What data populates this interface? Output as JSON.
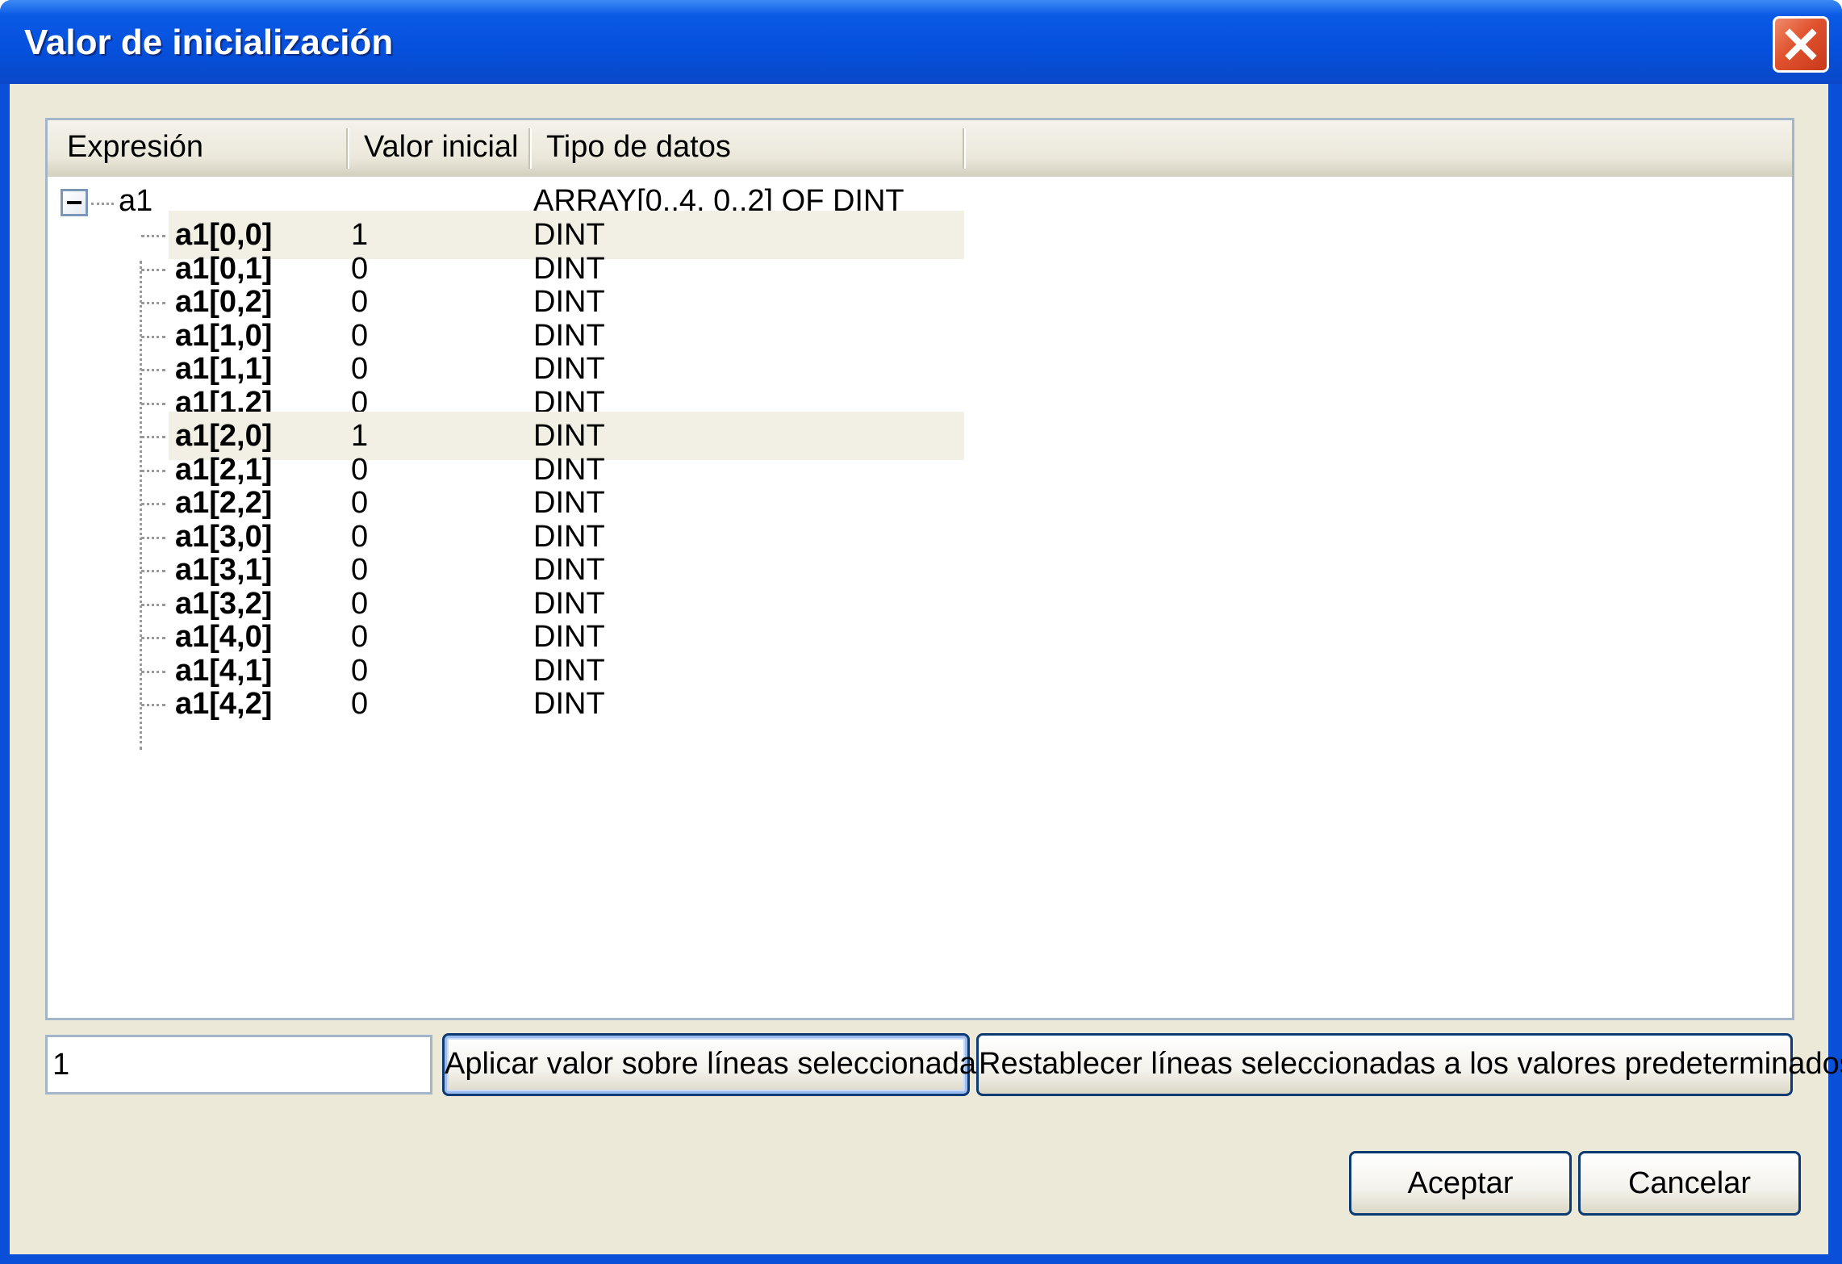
{
  "window": {
    "title": "Valor de inicialización",
    "close_icon": "close-icon"
  },
  "columns": [
    "Expresión",
    "Valor inicial",
    "Tipo de datos"
  ],
  "root": {
    "expression": "a1",
    "value": "",
    "type": "ARRAY[0..4, 0..2] OF DINT",
    "expanded": true
  },
  "rows": [
    {
      "expression": "a1[0,0]",
      "value": "1",
      "type": "DINT",
      "selected": true
    },
    {
      "expression": "a1[0,1]",
      "value": "0",
      "type": "DINT",
      "selected": false
    },
    {
      "expression": "a1[0,2]",
      "value": "0",
      "type": "DINT",
      "selected": false
    },
    {
      "expression": "a1[1,0]",
      "value": "0",
      "type": "DINT",
      "selected": false
    },
    {
      "expression": "a1[1,1]",
      "value": "0",
      "type": "DINT",
      "selected": false
    },
    {
      "expression": "a1[1,2]",
      "value": "0",
      "type": "DINT",
      "selected": false
    },
    {
      "expression": "a1[2,0]",
      "value": "1",
      "type": "DINT",
      "selected": true
    },
    {
      "expression": "a1[2,1]",
      "value": "0",
      "type": "DINT",
      "selected": false
    },
    {
      "expression": "a1[2,2]",
      "value": "0",
      "type": "DINT",
      "selected": false
    },
    {
      "expression": "a1[3,0]",
      "value": "0",
      "type": "DINT",
      "selected": false
    },
    {
      "expression": "a1[3,1]",
      "value": "0",
      "type": "DINT",
      "selected": false
    },
    {
      "expression": "a1[3,2]",
      "value": "0",
      "type": "DINT",
      "selected": false
    },
    {
      "expression": "a1[4,0]",
      "value": "0",
      "type": "DINT",
      "selected": false
    },
    {
      "expression": "a1[4,1]",
      "value": "0",
      "type": "DINT",
      "selected": false
    },
    {
      "expression": "a1[4,2]",
      "value": "0",
      "type": "DINT",
      "selected": false
    }
  ],
  "controls": {
    "value_input": "1",
    "apply_label": "Aplicar valor sobre líneas seleccionadas",
    "reset_label": "Restablecer líneas seleccionadas a los valores predeterminados",
    "ok_label": "Aceptar",
    "cancel_label": "Cancelar"
  },
  "colors": {
    "titlebar": "#0550dc",
    "dialog_background": "#ece9d8",
    "selected_row": "#f2efe4",
    "button_border": "#0c3a72"
  }
}
